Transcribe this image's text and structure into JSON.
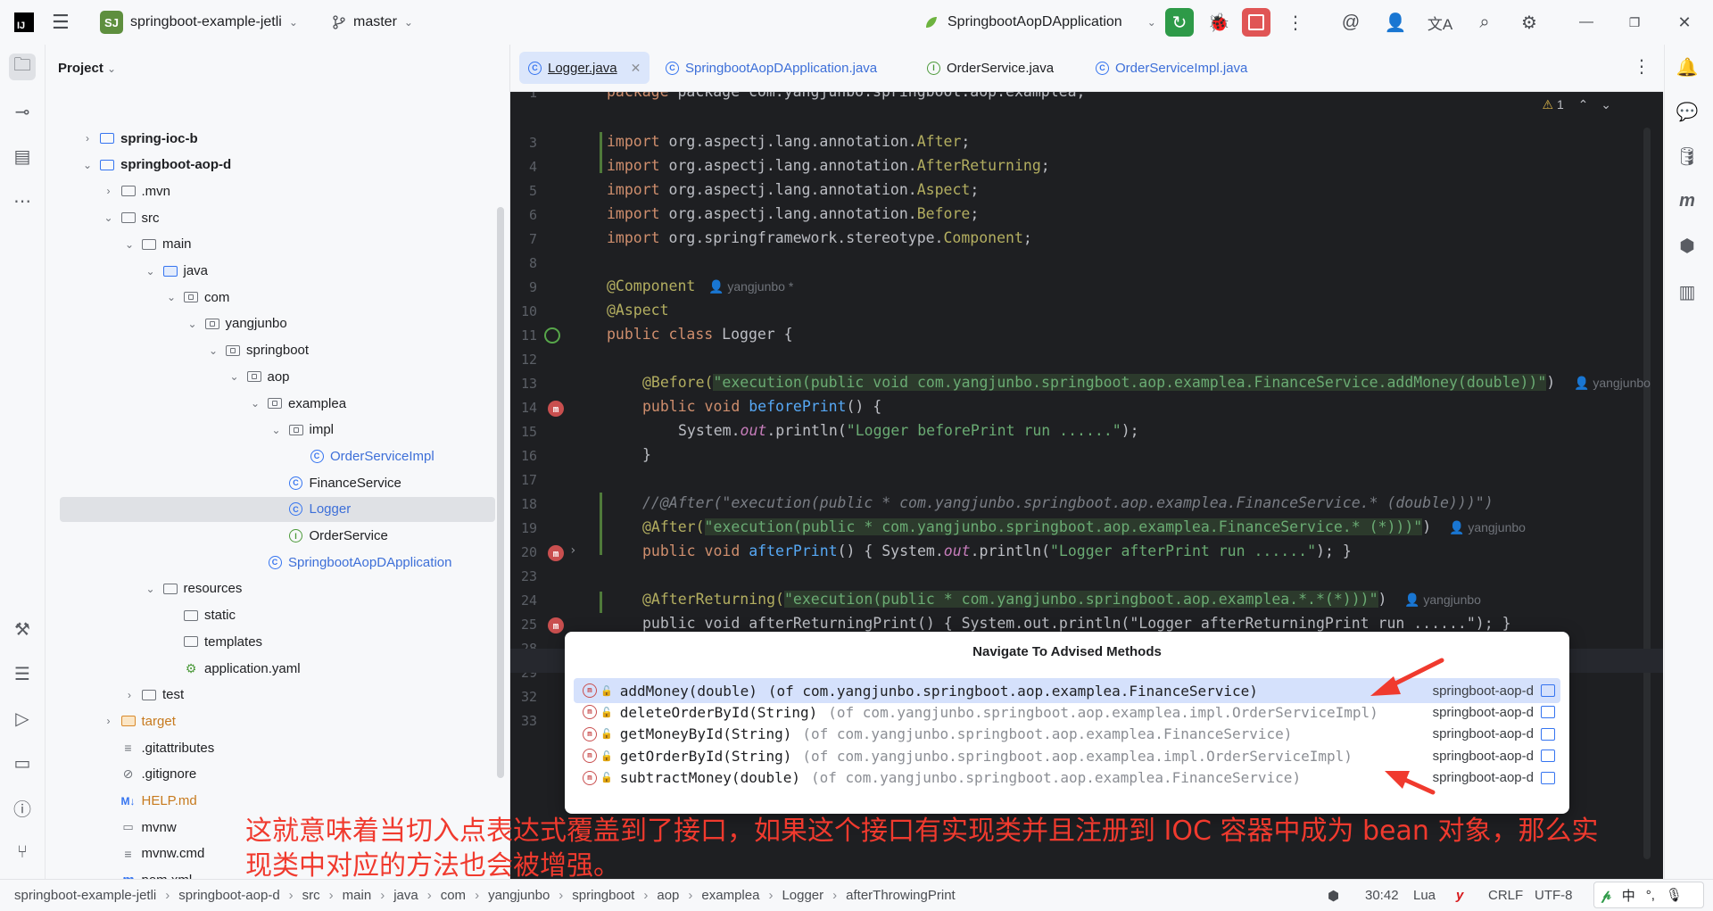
{
  "titlebar": {
    "project_badge": "SJ",
    "project_name": "springboot-example-jetli",
    "branch": "master",
    "run_config": "SpringbootAopDApplication"
  },
  "project_panel": {
    "title": "Project",
    "tree": [
      {
        "label": "spring-ioc-b",
        "bold": true,
        "depth": 0,
        "arrow": "›",
        "icon": "module"
      },
      {
        "label": "springboot-aop-d",
        "bold": true,
        "depth": 0,
        "arrow": "⌄",
        "icon": "module"
      },
      {
        "label": ".mvn",
        "depth": 1,
        "arrow": "›",
        "icon": "folder"
      },
      {
        "label": "src",
        "depth": 1,
        "arrow": "⌄",
        "icon": "folder"
      },
      {
        "label": "main",
        "depth": 2,
        "arrow": "⌄",
        "icon": "folder"
      },
      {
        "label": "java",
        "depth": 3,
        "arrow": "⌄",
        "icon": "folder-blue"
      },
      {
        "label": "com",
        "depth": 4,
        "arrow": "⌄",
        "icon": "package"
      },
      {
        "label": "yangjunbo",
        "depth": 5,
        "arrow": "⌄",
        "icon": "package"
      },
      {
        "label": "springboot",
        "depth": 6,
        "arrow": "⌄",
        "icon": "package"
      },
      {
        "label": "aop",
        "depth": 7,
        "arrow": "⌄",
        "icon": "package"
      },
      {
        "label": "examplea",
        "depth": 8,
        "arrow": "⌄",
        "icon": "package"
      },
      {
        "label": "impl",
        "depth": 9,
        "arrow": "⌄",
        "icon": "package"
      },
      {
        "label": "OrderServiceImpl",
        "depth": 10,
        "arrow": "",
        "icon": "class",
        "blue": true
      },
      {
        "label": "FinanceService",
        "depth": 9,
        "arrow": "",
        "icon": "class"
      },
      {
        "label": "Logger",
        "depth": 9,
        "arrow": "",
        "icon": "class",
        "blue": true,
        "selected": true
      },
      {
        "label": "OrderService",
        "depth": 9,
        "arrow": "",
        "icon": "interface"
      },
      {
        "label": "SpringbootAopDApplication",
        "depth": 8,
        "arrow": "",
        "icon": "class",
        "blue": true
      },
      {
        "label": "resources",
        "depth": 3,
        "arrow": "⌄",
        "icon": "folder"
      },
      {
        "label": "static",
        "depth": 4,
        "arrow": "",
        "icon": "folder"
      },
      {
        "label": "templates",
        "depth": 4,
        "arrow": "",
        "icon": "folder"
      },
      {
        "label": "application.yaml",
        "depth": 4,
        "arrow": "",
        "icon": "yaml"
      },
      {
        "label": "test",
        "depth": 2,
        "arrow": "›",
        "icon": "folder"
      },
      {
        "label": "target",
        "depth": 1,
        "arrow": "›",
        "icon": "folder-orange",
        "orange": true
      },
      {
        "label": ".gitattributes",
        "depth": 1,
        "arrow": "",
        "icon": "file"
      },
      {
        "label": ".gitignore",
        "depth": 1,
        "arrow": "",
        "icon": "ignore"
      },
      {
        "label": "HELP.md",
        "depth": 1,
        "arrow": "",
        "icon": "md",
        "orange": true
      },
      {
        "label": "mvnw",
        "depth": 1,
        "arrow": "",
        "icon": "terminal"
      },
      {
        "label": "mvnw.cmd",
        "depth": 1,
        "arrow": "",
        "icon": "file"
      },
      {
        "label": "pom.xml",
        "depth": 1,
        "arrow": "",
        "icon": "maven"
      }
    ]
  },
  "tabs": [
    {
      "label": "Logger.java",
      "active": true
    },
    {
      "label": "SpringbootAopDApplication.java",
      "active": false
    },
    {
      "label": "OrderService.java",
      "active": false,
      "dark": true
    },
    {
      "label": "OrderServiceImpl.java",
      "active": false
    }
  ],
  "editor": {
    "inspection_count": "1",
    "line_numbers": [
      "1",
      "3",
      "4",
      "5",
      "6",
      "7",
      "8",
      "9",
      "10",
      "11",
      "12",
      "13",
      "14",
      "15",
      "16",
      "17",
      "18",
      "19",
      "20",
      "23",
      "24",
      "25",
      "28",
      "29",
      "32",
      "33"
    ],
    "code": {
      "l1": "package com.yangjunbo.springboot.aop.examplea;",
      "l3a": "import ",
      "l3b": "org.aspectj.lang.annotation.",
      "l3c": "After",
      "l3d": ";",
      "l4c": "AfterReturning",
      "l5c": "Aspect",
      "l6c": "Before",
      "l7b": "org.springframework.stereotype.",
      "l7c": "Component",
      "l9": "@Component",
      "l10": "@Aspect",
      "l11a": "public class ",
      "l11b": "Logger {",
      "l13a": "@Before(",
      "l13b": "\"execution(public void com.yangjunbo.springboot.aop.examplea.FinanceService.addMoney(double))\"",
      "l13c": ")",
      "l14a": "public void ",
      "l14b": "beforePrint",
      "l14c": "() {",
      "l15a": "System.",
      "l15b": "out",
      "l15c": ".println(",
      "l15d": "\"Logger beforePrint run ......\"",
      "l15e": ");",
      "l16": "}",
      "l18": "//@After(\"execution(public * com.yangjunbo.springboot.aop.examplea.FinanceService.* (double)))\")",
      "l19a": "@After(",
      "l19b": "\"execution(public * com.yangjunbo.springboot.aop.examplea.FinanceService.* (*)))\"",
      "l19c": ")",
      "l20a": "public void ",
      "l20b": "afterPrint",
      "l20c": "() { System.",
      "l20d": "out",
      "l20e": ".println(",
      "l20f": "\"Logger afterPrint run ......\"",
      "l20g": "); }",
      "l24a": "@AfterReturning(",
      "l24b": "\"execution(public * com.yangjunbo.springboot.aop.examplea.*.*(*)))\"",
      "l24c": ")",
      "l25": "public void afterReturningPrint() { System.out.println(\"Logger afterReturningPrint run ......\"); }"
    },
    "author": "yangjunbo",
    "author_star": "yangjunbo *"
  },
  "popup": {
    "title": "Navigate To Advised Methods",
    "items": [
      {
        "method": "addMoney(double)",
        "of": "(of com.yangjunbo.springboot.aop.examplea.FinanceService)",
        "module": "springboot-aop-d",
        "selected": true
      },
      {
        "method": "deleteOrderById(String)",
        "of": "(of com.yangjunbo.springboot.aop.examplea.impl.OrderServiceImpl)",
        "module": "springboot-aop-d"
      },
      {
        "method": "getMoneyById(String)",
        "of": "(of com.yangjunbo.springboot.aop.examplea.FinanceService)",
        "module": "springboot-aop-d"
      },
      {
        "method": "getOrderById(String)",
        "of": "(of com.yangjunbo.springboot.aop.examplea.impl.OrderServiceImpl)",
        "module": "springboot-aop-d"
      },
      {
        "method": "subtractMoney(double)",
        "of": "(of com.yangjunbo.springboot.aop.examplea.FinanceService)",
        "module": "springboot-aop-d"
      }
    ]
  },
  "caption": "这就意味着当切入点表达式覆盖到了接口，如果这个接口有实现类并且注册到 IOC 容器中成为 bean 对象，那么实现类中对应的方法也会被增强。",
  "statusbar": {
    "breadcrumbs": [
      "springboot-example-jetli",
      "springboot-aop-d",
      "src",
      "main",
      "java",
      "com",
      "yangjunbo",
      "springboot",
      "aop",
      "examplea",
      "Logger",
      "afterThrowingPrint"
    ],
    "position": "30:42",
    "lang": "Lua",
    "line_sep": "CRLF",
    "encoding": "UTF-8",
    "ime": "中"
  },
  "colors": {
    "accent": "#3574f0",
    "run_green": "#2e9a48",
    "stop_red": "#e05555",
    "arrow_red": "#f03a2e",
    "editor_bg": "#1e1f22"
  }
}
